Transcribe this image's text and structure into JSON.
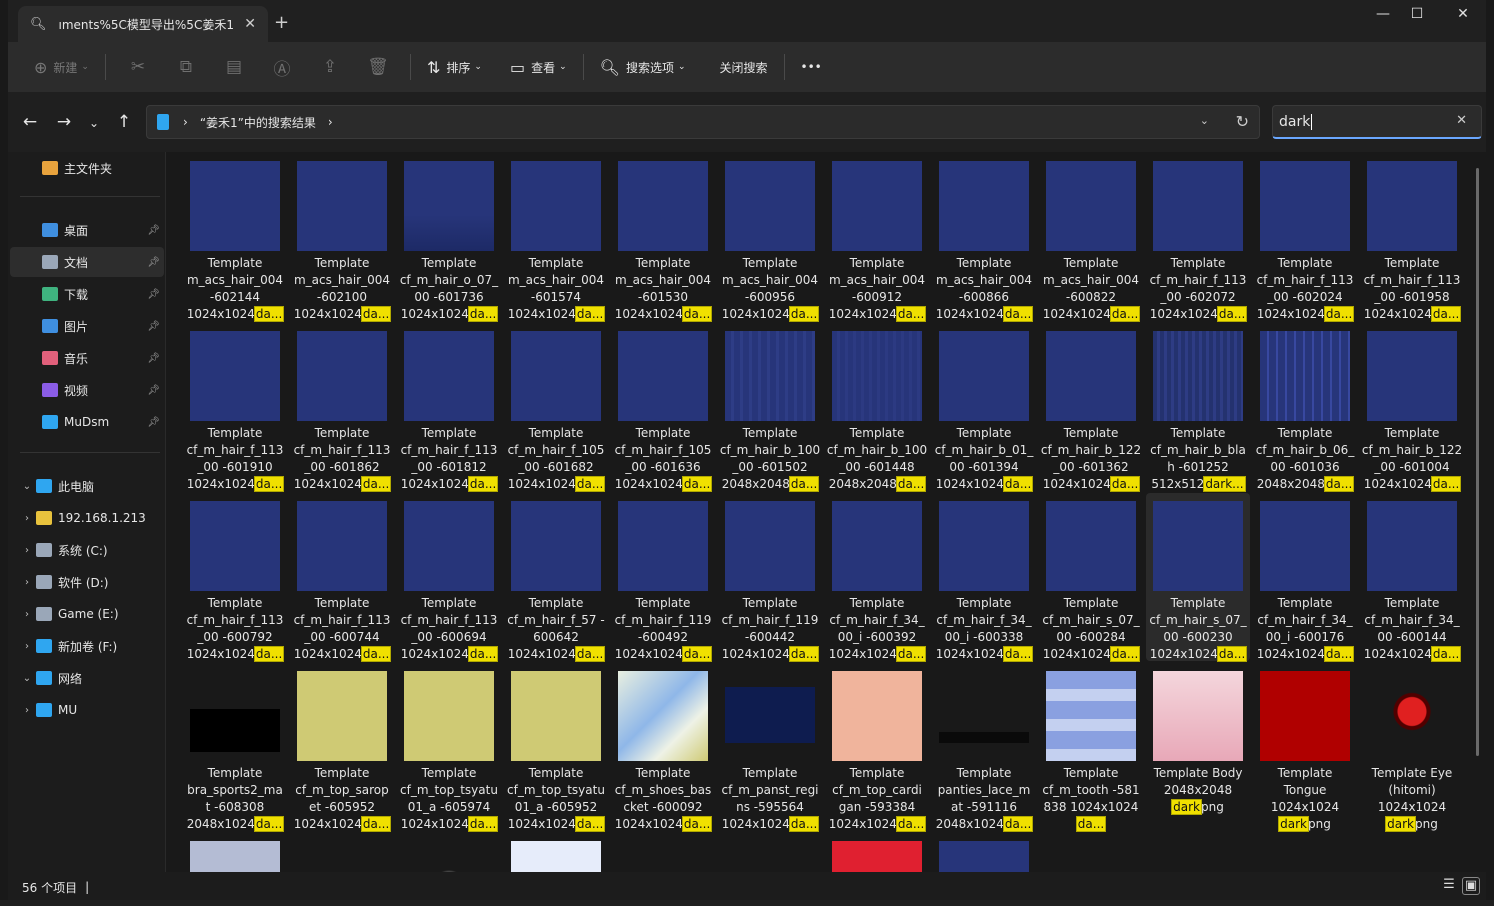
{
  "window": {
    "tab_title": "ıments%5C模型导出%5C姜禾1",
    "folder_icon": "folder-icon",
    "close_tab": "✕",
    "new_tab": "+",
    "minimize": "—",
    "maximize": "☐",
    "close": "✕"
  },
  "toolbar": {
    "new_label": "新建",
    "sort_label": "排序",
    "view_label": "查看",
    "search_options_label": "搜索选项",
    "close_search_label": "关闭搜索",
    "more": "•••"
  },
  "nav": {
    "breadcrumb": "“姜禾1”中的搜索结果",
    "search_value": "dark"
  },
  "sidebar": {
    "items": [
      {
        "label": "主文件夹",
        "color": "#e8a33d"
      },
      {
        "label": "桌面",
        "color": "#3f8fe0"
      },
      {
        "label": "文档",
        "color": "#9aa7b8"
      },
      {
        "label": "下载",
        "color": "#3fb37f"
      },
      {
        "label": "图片",
        "color": "#3f8fe0"
      },
      {
        "label": "音乐",
        "color": "#e2607b"
      },
      {
        "label": "视频",
        "color": "#8a5ce6"
      },
      {
        "label": "MuDsm",
        "color": "#2fa6f0"
      },
      {
        "label": "此电脑",
        "color": "#2fa6f0"
      },
      {
        "label": "192.168.1.213",
        "color": "#e8c23d"
      },
      {
        "label": "系统 (C:)",
        "color": "#9aa7b8"
      },
      {
        "label": "软件 (D:)",
        "color": "#9aa7b8"
      },
      {
        "label": "Game (E:)",
        "color": "#9aa7b8"
      },
      {
        "label": "新加卷 (F:)",
        "color": "#2fa6f0"
      },
      {
        "label": "网络",
        "color": "#2fa6f0"
      },
      {
        "label": "MU",
        "color": "#2fa6f0"
      }
    ]
  },
  "files": [
    {
      "l1": "Template",
      "l2": "m_acs_hair_004",
      "l3": "-602144",
      "dim": "1024x1024",
      "tag": "da..."
    },
    {
      "l1": "Template",
      "l2": "m_acs_hair_004",
      "l3": "-602100",
      "dim": "1024x1024",
      "tag": "da..."
    },
    {
      "l1": "Template",
      "l2": "cf_m_hair_o_07_",
      "l3": "00 -601736",
      "dim": "1024x1024",
      "tag": "da..."
    },
    {
      "l1": "Template",
      "l2": "m_acs_hair_004",
      "l3": "-601574",
      "dim": "1024x1024",
      "tag": "da..."
    },
    {
      "l1": "Template",
      "l2": "m_acs_hair_004",
      "l3": "-601530",
      "dim": "1024x1024",
      "tag": "da..."
    },
    {
      "l1": "Template",
      "l2": "m_acs_hair_004",
      "l3": "-600956",
      "dim": "1024x1024",
      "tag": "da..."
    },
    {
      "l1": "Template",
      "l2": "m_acs_hair_004",
      "l3": "-600912",
      "dim": "1024x1024",
      "tag": "da..."
    },
    {
      "l1": "Template",
      "l2": "m_acs_hair_004",
      "l3": "-600866",
      "dim": "1024x1024",
      "tag": "da..."
    },
    {
      "l1": "Template",
      "l2": "m_acs_hair_004",
      "l3": "-600822",
      "dim": "1024x1024",
      "tag": "da..."
    },
    {
      "l1": "Template",
      "l2": "cf_m_hair_f_113",
      "l3": "_00 -602072",
      "dim": "1024x1024",
      "tag": "da..."
    },
    {
      "l1": "Template",
      "l2": "cf_m_hair_f_113",
      "l3": "_00 -602024",
      "dim": "1024x1024",
      "tag": "da..."
    },
    {
      "l1": "Template",
      "l2": "cf_m_hair_f_113",
      "l3": "_00 -601958",
      "dim": "1024x1024",
      "tag": "da..."
    },
    {
      "l1": "Template",
      "l2": "cf_m_hair_f_113",
      "l3": "_00 -601910",
      "dim": "1024x1024",
      "tag": "da..."
    },
    {
      "l1": "Template",
      "l2": "cf_m_hair_f_113",
      "l3": "_00 -601862",
      "dim": "1024x1024",
      "tag": "da..."
    },
    {
      "l1": "Template",
      "l2": "cf_m_hair_f_113",
      "l3": "_00 -601812",
      "dim": "1024x1024",
      "tag": "da..."
    },
    {
      "l1": "Template",
      "l2": "cf_m_hair_f_105",
      "l3": "_00 -601682",
      "dim": "1024x1024",
      "tag": "da..."
    },
    {
      "l1": "Template",
      "l2": "cf_m_hair_f_105",
      "l3": "_00 -601636",
      "dim": "1024x1024",
      "tag": "da..."
    },
    {
      "l1": "Template",
      "l2": "cf_m_hair_b_100",
      "l3": "_00 -601502",
      "dim": "2048x2048",
      "tag": "da..."
    },
    {
      "l1": "Template",
      "l2": "cf_m_hair_b_100",
      "l3": "_00 -601448",
      "dim": "2048x2048",
      "tag": "da..."
    },
    {
      "l1": "Template",
      "l2": "cf_m_hair_b_01_",
      "l3": "00 -601394",
      "dim": "1024x1024",
      "tag": "da..."
    },
    {
      "l1": "Template",
      "l2": "cf_m_hair_b_122",
      "l3": "_00 -601362",
      "dim": "1024x1024",
      "tag": "da..."
    },
    {
      "l1": "Template",
      "l2": "cf_m_hair_b_bla",
      "l3": "h -601252",
      "dim": "512x512",
      "tag": "dark..."
    },
    {
      "l1": "Template",
      "l2": "cf_m_hair_b_06_",
      "l3": "00 -601036",
      "dim": "2048x2048",
      "tag": "da..."
    },
    {
      "l1": "Template",
      "l2": "cf_m_hair_b_122",
      "l3": "_00 -601004",
      "dim": "1024x1024",
      "tag": "da..."
    },
    {
      "l1": "Template",
      "l2": "cf_m_hair_f_113",
      "l3": "_00 -600792",
      "dim": "1024x1024",
      "tag": "da..."
    },
    {
      "l1": "Template",
      "l2": "cf_m_hair_f_113",
      "l3": "_00 -600744",
      "dim": "1024x1024",
      "tag": "da..."
    },
    {
      "l1": "Template",
      "l2": "cf_m_hair_f_113",
      "l3": "_00 -600694",
      "dim": "1024x1024",
      "tag": "da..."
    },
    {
      "l1": "Template",
      "l2": "cf_m_hair_f_57 -",
      "l3": "600642",
      "dim": "1024x1024",
      "tag": "da..."
    },
    {
      "l1": "Template",
      "l2": "cf_m_hair_f_119",
      "l3": "-600492",
      "dim": "1024x1024",
      "tag": "da..."
    },
    {
      "l1": "Template",
      "l2": "cf_m_hair_f_119",
      "l3": "-600442",
      "dim": "1024x1024",
      "tag": "da..."
    },
    {
      "l1": "Template",
      "l2": "cf_m_hair_f_34_",
      "l3": "00_i -600392",
      "dim": "1024x1024",
      "tag": "da..."
    },
    {
      "l1": "Template",
      "l2": "cf_m_hair_f_34_",
      "l3": "00_i -600338",
      "dim": "1024x1024",
      "tag": "da..."
    },
    {
      "l1": "Template",
      "l2": "cf_m_hair_s_07_",
      "l3": "00 -600284",
      "dim": "1024x1024",
      "tag": "da..."
    },
    {
      "l1": "Template",
      "l2": "cf_m_hair_s_07_",
      "l3": "00 -600230",
      "dim": "1024x1024",
      "tag": "da..."
    },
    {
      "l1": "Template",
      "l2": "cf_m_hair_f_34_",
      "l3": "00_i -600176",
      "dim": "1024x1024",
      "tag": "da..."
    },
    {
      "l1": "Template",
      "l2": "cf_m_hair_f_34_",
      "l3": "00 -600144",
      "dim": "1024x1024",
      "tag": "da..."
    },
    {
      "l1": "Template",
      "l2": "bra_sports2_ma",
      "l3": "t -608308",
      "dim": "2048x1024",
      "tag": "da..."
    },
    {
      "l1": "Template",
      "l2": "cf_m_top_sarop",
      "l3": "et -605952",
      "dim": "1024x1024",
      "tag": "da..."
    },
    {
      "l1": "Template",
      "l2": "cf_m_top_tsyatu",
      "l3": "01_a -605974",
      "dim": "1024x1024",
      "tag": "da..."
    },
    {
      "l1": "Template",
      "l2": "cf_m_top_tsyatu",
      "l3": "01_a -605952",
      "dim": "1024x1024",
      "tag": "da..."
    },
    {
      "l1": "Template",
      "l2": "cf_m_shoes_bas",
      "l3": "cket -600092",
      "dim": "1024x1024",
      "tag": "da..."
    },
    {
      "l1": "Template",
      "l2": "cf_m_panst_regi",
      "l3": "ns -595564",
      "dim": "1024x1024",
      "tag": "da..."
    },
    {
      "l1": "Template",
      "l2": "cf_m_top_cardi",
      "l3": "gan -593384",
      "dim": "1024x1024",
      "tag": "da..."
    },
    {
      "l1": "Template",
      "l2": "panties_lace_m",
      "l3": "at -591116",
      "dim": "2048x1024",
      "tag": "da..."
    },
    {
      "l1": "Template",
      "l2": "cf_m_tooth -581",
      "l3": "838 1024x1024",
      "dim": "",
      "tag": "da..."
    },
    {
      "l1": "Template Body",
      "l2": "2048x2048",
      "l3": "",
      "dim": "",
      "tag": "dark",
      "ext": "png"
    },
    {
      "l1": "Template",
      "l2": "Tongue",
      "l3": "1024x1024",
      "dim": "",
      "tag": "dark",
      "ext": "png"
    },
    {
      "l1": "Template Eye",
      "l2": "(hitomi)",
      "l3": "1024x1024",
      "dim": "",
      "tag": "dark",
      "ext": "png"
    }
  ],
  "status": {
    "count": "56 个项目",
    "cursor": "|"
  },
  "colors": {
    "accent": "#6aa7ff",
    "highlight": "#f0e000",
    "thumb_blue": "#27357a"
  }
}
